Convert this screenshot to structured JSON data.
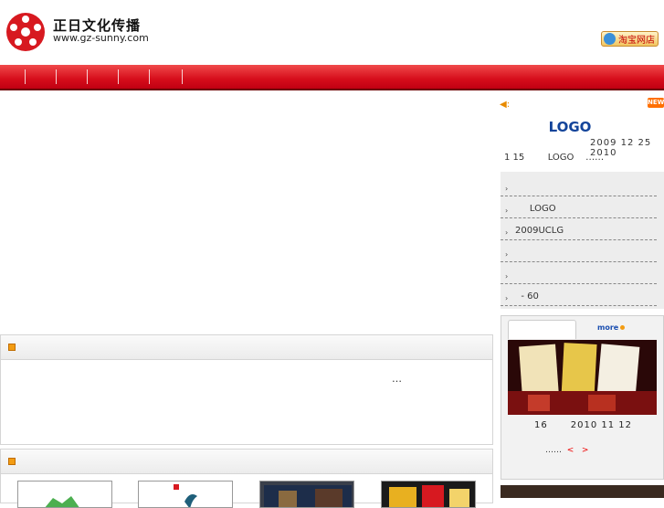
{
  "header": {
    "brand_name": "正日文化传播",
    "brand_url": "www.gz-sunny.com",
    "taobao_label": "淘宝网店"
  },
  "colors": {
    "nav_red": "#d60d1b",
    "news_title_blue": "#13449a",
    "accent_orange": "#f39c12"
  },
  "news": {
    "badge": "NEW",
    "headline": "LOGO",
    "date": "2009 12 25  2010",
    "summary": "1 15        LOGO    ……",
    "items": [
      {
        "text": ""
      },
      {
        "text": "     LOGO"
      },
      {
        "text": "2009UCLG"
      },
      {
        "text": ""
      },
      {
        "text": ""
      },
      {
        "text": "  - 60"
      }
    ]
  },
  "about": {
    "ellipsis": "…"
  },
  "showcase": {
    "more_label": "more",
    "caption": "16      2010 11 12",
    "nav_ellipsis": "……",
    "prev": "<",
    "next": ">"
  }
}
